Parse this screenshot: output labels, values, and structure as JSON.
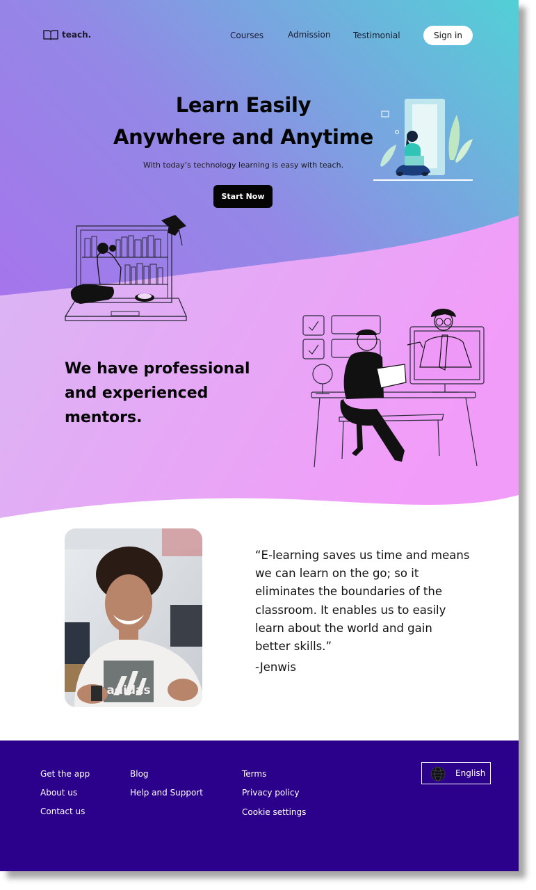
{
  "nav": {
    "logo_text": "teach.",
    "links": [
      "Courses",
      "Admission",
      "Testimonial"
    ],
    "signin_label": "Sign in"
  },
  "hero": {
    "title_line1": "Learn Easily",
    "title_line2": "Anywhere and Anytime",
    "subtitle": "With today’s technology learning is easy with teach.",
    "cta_label": "Start Now"
  },
  "mentors": {
    "heading": "We have professional and experienced mentors."
  },
  "testimonial": {
    "quote": "“E-learning saves us time and means we can learn on the go; so it eliminates the boundaries of the classroom. It enables us to easily learn about the world and gain better skills.”",
    "author": "-Jenwis",
    "photo_shirt_text": "adidas"
  },
  "footer": {
    "col1": [
      "Get the app",
      "About us",
      "Contact us"
    ],
    "col2": [
      "Blog",
      "Help and Support"
    ],
    "col3": [
      "Terms",
      "Privacy policy",
      "Cookie settings"
    ],
    "language": "English"
  },
  "colors": {
    "hero_gradient_start": "#b46cf0",
    "hero_gradient_end": "#52d0d6",
    "wave_pink": "#f3a4f8",
    "wave_lavender": "#dab8f2",
    "footer_bg": "#2b008a",
    "cta_bg": "#050505"
  }
}
